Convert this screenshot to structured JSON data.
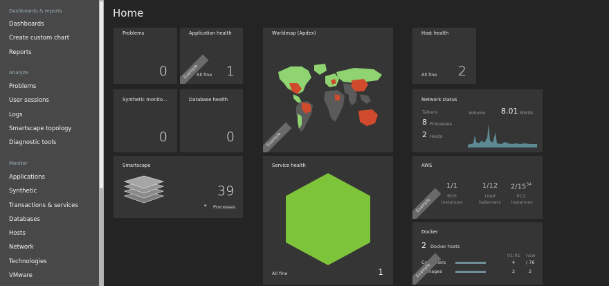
{
  "sidebar": {
    "sections": [
      {
        "title": "Dashboards & reports",
        "items": [
          "Dashboards",
          "Create custom chart",
          "Reports"
        ]
      },
      {
        "title": "Analyze",
        "items": [
          "Problems",
          "User sessions",
          "Logs",
          "Smartscape topology",
          "Diagnostic tools"
        ]
      },
      {
        "title": "Monitor",
        "items": [
          "Applications",
          "Synthetic",
          "Transactions & services",
          "Databases",
          "Hosts",
          "Network",
          "Technologies",
          "VMware"
        ]
      }
    ]
  },
  "page": {
    "title": "Home"
  },
  "tiles": {
    "problems": {
      "title": "Problems",
      "value": "0"
    },
    "app_health": {
      "title": "Application health",
      "status": "All fine",
      "value": "1",
      "ribbon": "Example"
    },
    "worldmap": {
      "title": "Worldmap (Apdex)",
      "ribbon": "Example"
    },
    "host_health": {
      "title": "Host health",
      "status": "All fine",
      "value": "2"
    },
    "synthetic": {
      "title": "Synthetic monito...",
      "value": "0"
    },
    "db_health": {
      "title": "Database health",
      "value": "0"
    },
    "network": {
      "title": "Network status",
      "talkers_label": "Talkers",
      "processes_value": "8",
      "processes_label": "Processes",
      "hosts_value": "2",
      "hosts_label": "Hosts",
      "volume_label": "Volume",
      "volume_value": "8.01",
      "volume_unit": "Mbit/s"
    },
    "smartscape": {
      "title": "Smartscape",
      "value": "39",
      "label": "Processes"
    },
    "service_health": {
      "title": "Service health",
      "status": "All fine",
      "value": "1",
      "hex_color": "#7ec43b"
    },
    "aws": {
      "title": "AWS",
      "ribbon": "Example",
      "stats": [
        {
          "value": "1/1",
          "label1": "RDS",
          "label2": "instances"
        },
        {
          "value": "1/12",
          "label1": "Load",
          "label2": "balancers"
        },
        {
          "value": "2/15",
          "sup": "34",
          "label1": "EC2",
          "label2": "instances"
        }
      ]
    },
    "docker": {
      "title": "Docker",
      "ribbon": "Example",
      "hosts_value": "2",
      "hosts_label": "Docker hosts",
      "col1": "01:01",
      "col2": "now",
      "rows": [
        {
          "label": "Containers",
          "v1": "4",
          "v2": "/ 76"
        },
        {
          "label": "Images",
          "v1": "2",
          "v2": "2"
        }
      ]
    }
  }
}
